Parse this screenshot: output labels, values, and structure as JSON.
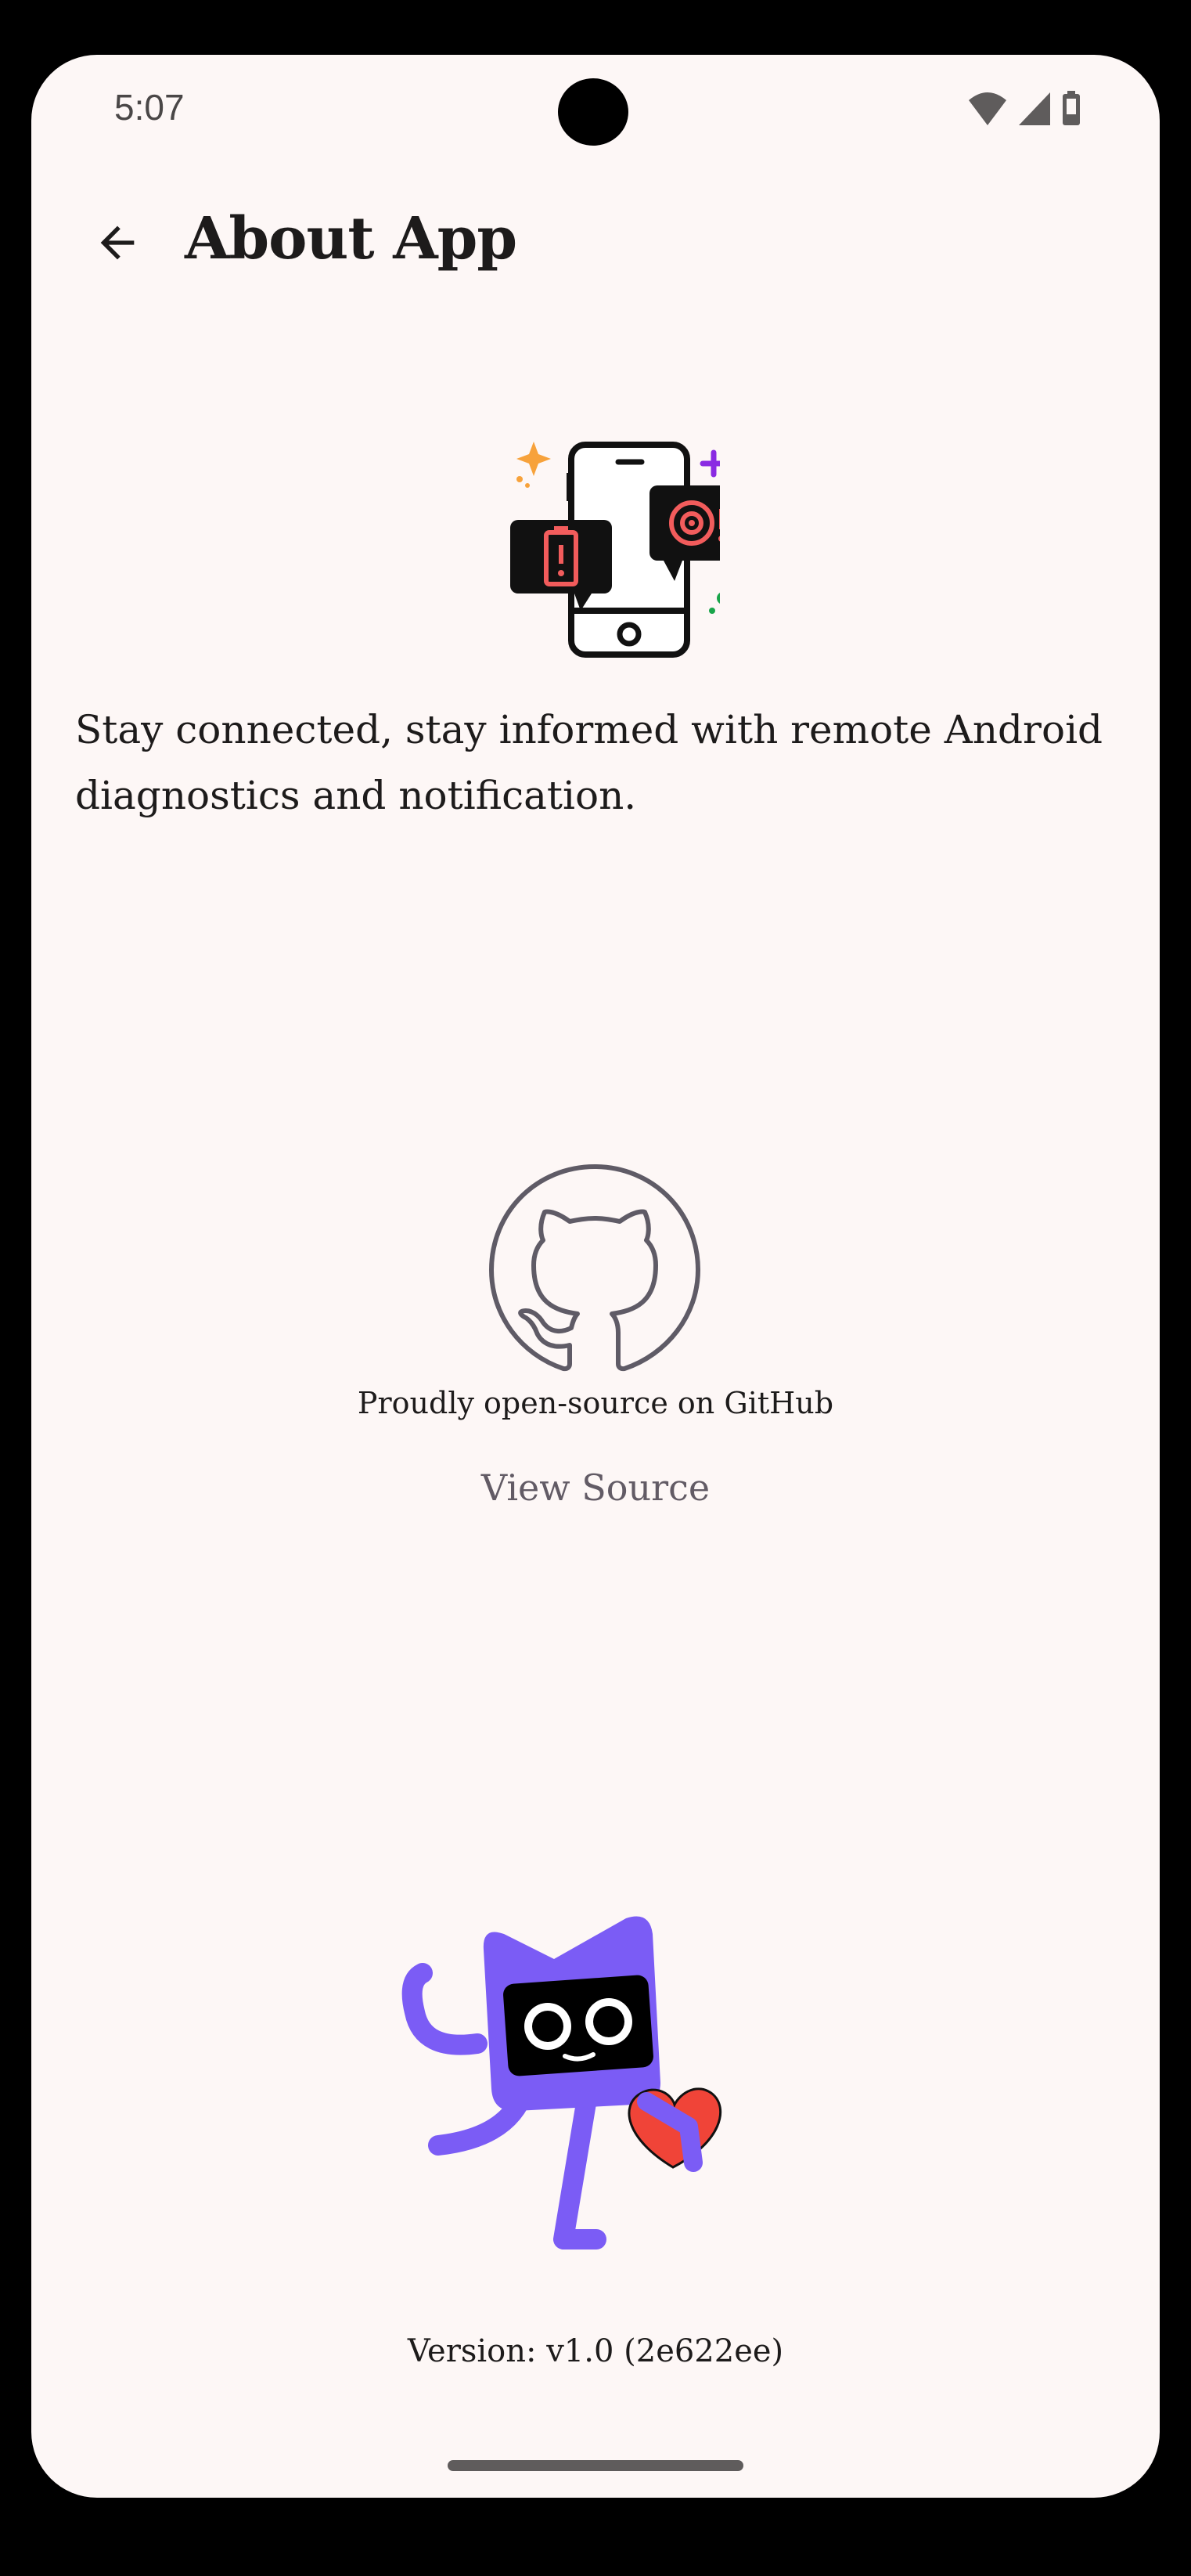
{
  "status_bar": {
    "time": "5:07",
    "icons": [
      "wifi-icon",
      "cellular-signal-icon",
      "battery-icon"
    ]
  },
  "app_bar": {
    "back_icon": "arrow-back-icon",
    "title": "About App"
  },
  "hero": {
    "illustration": "phone-notifications-illustration"
  },
  "description": "Stay connected, stay informed with remote Android diagnostics and notification.",
  "github": {
    "icon": "github-icon",
    "caption": "Proudly open-source on GitHub",
    "link_label": "View Source"
  },
  "mascot": {
    "illustration": "cat-mascot-heart-illustration"
  },
  "version": "Version: v1.0 (2e622ee)",
  "colors": {
    "background": "#fdf7f6",
    "text": "#1d1b1b",
    "muted": "#625b65",
    "mascot_purple": "#7b5cf5",
    "heart_red": "#f04438",
    "alert_red": "#f25c5c"
  }
}
